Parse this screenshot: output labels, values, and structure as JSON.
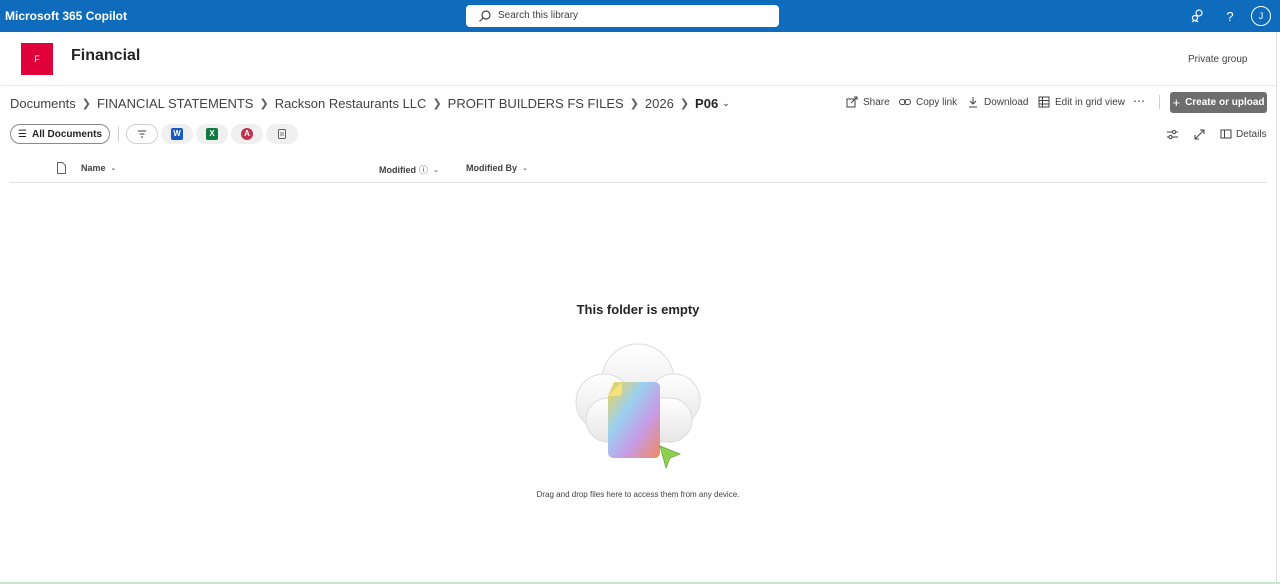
{
  "topbar": {
    "app_title": "Microsoft 365 Copilot",
    "search_placeholder": "Search this library",
    "avatar_initial": "J"
  },
  "site": {
    "logo_letter": "F",
    "name": "Financial",
    "privacy": "Private group"
  },
  "breadcrumb": {
    "items": [
      "Documents",
      "FINANCIAL STATEMENTS",
      "Rackson Restaurants LLC",
      "PROFIT BUILDERS FS FILES",
      "2026"
    ],
    "current": "P06"
  },
  "commands": {
    "share": "Share",
    "copy_link": "Copy link",
    "download": "Download",
    "edit_grid": "Edit in grid view",
    "create_upload": "Create or upload"
  },
  "filters": {
    "view": "All Documents",
    "file_types": [
      "word",
      "excel",
      "pdf",
      "other"
    ]
  },
  "toolbar_right": {
    "details": "Details"
  },
  "columns": {
    "name": "Name",
    "modified": "Modified",
    "modified_by": "Modified By"
  },
  "empty_state": {
    "title": "This folder is empty",
    "hint": "Drag and drop files here to access them from any device."
  },
  "colors": {
    "brand_blue": "#0f6cbd",
    "logo_red": "#e0003a",
    "word": "#185abd",
    "excel": "#107c41",
    "pdf": "#c4314b"
  }
}
